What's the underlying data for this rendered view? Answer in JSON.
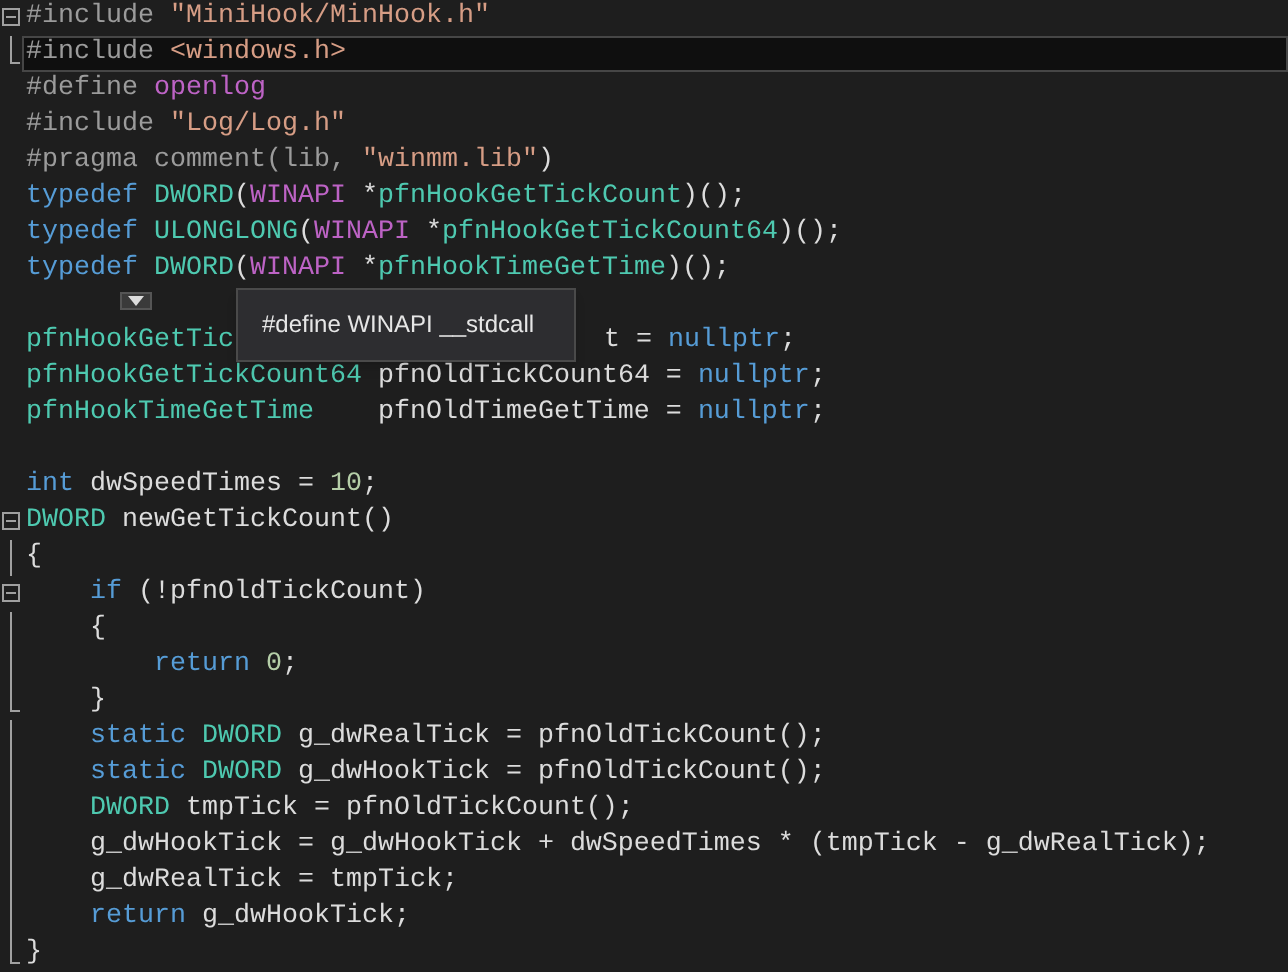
{
  "editor": {
    "lines": [
      {
        "kind": "fold_start",
        "current": false,
        "tokens": [
          {
            "text": "#include ",
            "kind": "preproc"
          },
          {
            "text": "\"MiniHook/MinHook.h\"",
            "kind": "string"
          }
        ]
      },
      {
        "kind": "fold_end",
        "current": true,
        "tokens": [
          {
            "text": "#include ",
            "kind": "preproc"
          },
          {
            "text": "<windows.h>",
            "kind": "string"
          }
        ]
      },
      {
        "kind": "plain",
        "current": false,
        "tokens": [
          {
            "text": "#define ",
            "kind": "preproc"
          },
          {
            "text": "openlog",
            "kind": "macro"
          }
        ]
      },
      {
        "kind": "plain",
        "current": false,
        "tokens": [
          {
            "text": "#include ",
            "kind": "preproc"
          },
          {
            "text": "\"Log/Log.h\"",
            "kind": "string"
          }
        ]
      },
      {
        "kind": "plain",
        "current": false,
        "tokens": [
          {
            "text": "#pragma comment(lib, ",
            "kind": "preproc"
          },
          {
            "text": "\"winmm.lib\"",
            "kind": "string"
          },
          {
            "text": ")",
            "kind": "plain"
          }
        ]
      },
      {
        "kind": "plain",
        "current": false,
        "tokens": [
          {
            "text": "typedef ",
            "kind": "keyword"
          },
          {
            "text": "DWORD",
            "kind": "type"
          },
          {
            "text": "(",
            "kind": "plain"
          },
          {
            "text": "WINAPI",
            "kind": "macro"
          },
          {
            "text": " *",
            "kind": "plain"
          },
          {
            "text": "pfnHookGetTickCount",
            "kind": "type"
          },
          {
            "text": ")();",
            "kind": "plain"
          }
        ]
      },
      {
        "kind": "plain",
        "current": false,
        "tokens": [
          {
            "text": "typedef ",
            "kind": "keyword"
          },
          {
            "text": "ULONGLONG",
            "kind": "type"
          },
          {
            "text": "(",
            "kind": "plain"
          },
          {
            "text": "WINAPI",
            "kind": "macro"
          },
          {
            "text": " *",
            "kind": "plain"
          },
          {
            "text": "pfnHookGetTickCount64",
            "kind": "type"
          },
          {
            "text": ")();",
            "kind": "plain"
          }
        ]
      },
      {
        "kind": "plain",
        "current": false,
        "tokens": [
          {
            "text": "typedef ",
            "kind": "keyword"
          },
          {
            "text": "DWORD",
            "kind": "type"
          },
          {
            "text": "(",
            "kind": "plain"
          },
          {
            "text": "WINAPI",
            "kind": "macro"
          },
          {
            "text": " *",
            "kind": "plain"
          },
          {
            "text": "pfnHookTimeGetTime",
            "kind": "type"
          },
          {
            "text": ")();",
            "kind": "plain"
          }
        ]
      },
      {
        "kind": "blank",
        "current": false
      },
      {
        "kind": "plain",
        "current": false,
        "tokens": [
          {
            "text": "pfnHookGetTic",
            "kind": "type"
          },
          {
            "kind": "covered"
          },
          {
            "text": "t = ",
            "kind": "plain"
          },
          {
            "text": "nullptr",
            "kind": "keyword"
          },
          {
            "text": ";",
            "kind": "plain"
          }
        ]
      },
      {
        "kind": "plain",
        "current": false,
        "tokens": [
          {
            "text": "pfnHookGetTickCount64",
            "kind": "type"
          },
          {
            "text": " pfnOldTickCount64 = ",
            "kind": "plain"
          },
          {
            "text": "nullptr",
            "kind": "keyword"
          },
          {
            "text": ";",
            "kind": "plain"
          }
        ]
      },
      {
        "kind": "plain",
        "current": false,
        "tokens": [
          {
            "text": "pfnHookTimeGetTime",
            "kind": "type"
          },
          {
            "text": "    pfnOldTimeGetTime = ",
            "kind": "plain"
          },
          {
            "text": "nullptr",
            "kind": "keyword"
          },
          {
            "text": ";",
            "kind": "plain"
          }
        ]
      },
      {
        "kind": "blank",
        "current": false
      },
      {
        "kind": "plain",
        "current": false,
        "tokens": [
          {
            "text": "int",
            "kind": "keyword"
          },
          {
            "text": " dwSpeedTimes = ",
            "kind": "plain"
          },
          {
            "text": "10",
            "kind": "number"
          },
          {
            "text": ";",
            "kind": "plain"
          }
        ]
      },
      {
        "kind": "fold_start",
        "current": false,
        "tokens": [
          {
            "text": "DWORD",
            "kind": "type"
          },
          {
            "text": " newGetTickCount()",
            "kind": "plain"
          }
        ]
      },
      {
        "kind": "fold_inner",
        "current": false,
        "tokens": [
          {
            "text": "{",
            "kind": "plain"
          }
        ]
      },
      {
        "kind": "fold_start",
        "current": false,
        "tokens": [
          {
            "text": "    if",
            "kind": "keyword"
          },
          {
            "text": " (!pfnOldTickCount)",
            "kind": "plain"
          }
        ]
      },
      {
        "kind": "fold_inner",
        "current": false,
        "tokens": [
          {
            "text": "    {",
            "kind": "plain"
          }
        ]
      },
      {
        "kind": "fold_inner",
        "current": false,
        "tokens": [
          {
            "text": "        return ",
            "kind": "keyword"
          },
          {
            "text": "0",
            "kind": "number"
          },
          {
            "text": ";",
            "kind": "plain"
          }
        ]
      },
      {
        "kind": "fold_end",
        "current": false,
        "tokens": [
          {
            "text": "    }",
            "kind": "plain"
          }
        ]
      },
      {
        "kind": "fold_inner",
        "current": false,
        "tokens": [
          {
            "text": "    static ",
            "kind": "keyword"
          },
          {
            "text": "DWORD",
            "kind": "type"
          },
          {
            "text": " g_dwRealTick = pfnOldTickCount();",
            "kind": "plain"
          }
        ]
      },
      {
        "kind": "fold_inner",
        "current": false,
        "tokens": [
          {
            "text": "    static ",
            "kind": "keyword"
          },
          {
            "text": "DWORD",
            "kind": "type"
          },
          {
            "text": " g_dwHookTick = pfnOldTickCount();",
            "kind": "plain"
          }
        ]
      },
      {
        "kind": "fold_inner",
        "current": false,
        "tokens": [
          {
            "text": "    DWORD",
            "kind": "type"
          },
          {
            "text": " tmpTick = pfnOldTickCount();",
            "kind": "plain"
          }
        ]
      },
      {
        "kind": "fold_inner",
        "current": false,
        "tokens": [
          {
            "text": "    g_dwHookTick = g_dwHookTick + dwSpeedTimes * (tmpTick - g_dwRealTick);",
            "kind": "plain"
          }
        ]
      },
      {
        "kind": "fold_inner",
        "current": false,
        "tokens": [
          {
            "text": "    g_dwRealTick = tmpTick;",
            "kind": "plain"
          }
        ]
      },
      {
        "kind": "fold_inner",
        "current": false,
        "tokens": [
          {
            "text": "    return",
            "kind": "keyword"
          },
          {
            "text": " g_dwHookTick;",
            "kind": "plain"
          }
        ]
      },
      {
        "kind": "fold_end",
        "current": false,
        "tokens": [
          {
            "text": "}",
            "kind": "plain"
          }
        ]
      }
    ]
  },
  "quick_info": {
    "text": "#define WINAPI __stdcall"
  }
}
